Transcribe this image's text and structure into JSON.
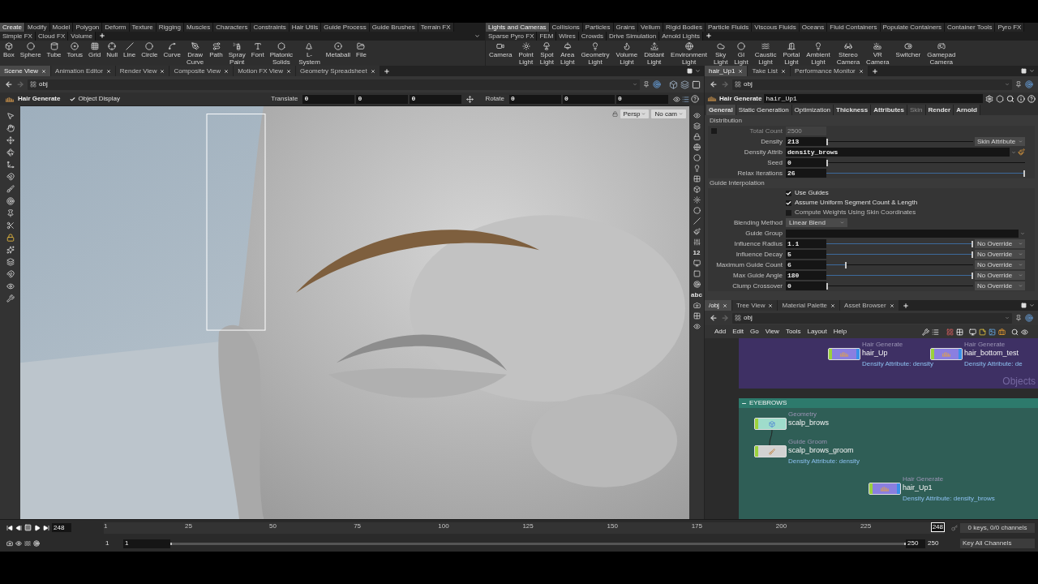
{
  "shelf": {
    "left_tabs": [
      {
        "label": "Create",
        "selected": true
      },
      {
        "label": "Modify",
        "selected": false
      },
      {
        "label": "Model",
        "selected": false
      },
      {
        "label": "Polygon",
        "selected": false
      },
      {
        "label": "Deform",
        "selected": false
      },
      {
        "label": "Texture",
        "selected": false
      },
      {
        "label": "Rigging",
        "selected": false
      },
      {
        "label": "Muscles",
        "selected": false
      },
      {
        "label": "Characters",
        "selected": false
      },
      {
        "label": "Constraints",
        "selected": false
      },
      {
        "label": "Hair Utils",
        "selected": false
      },
      {
        "label": "Guide Process",
        "selected": false
      },
      {
        "label": "Guide Brushes",
        "selected": false
      },
      {
        "label": "Terrain FX",
        "selected": false
      },
      {
        "label": "Simple FX",
        "selected": false
      },
      {
        "label": "Cloud FX",
        "selected": false
      },
      {
        "label": "Volume",
        "selected": false
      }
    ],
    "left_tools": [
      "Box",
      "Sphere",
      "Tube",
      "Torus",
      "Grid",
      "Null",
      "Line",
      "Circle",
      "Curve",
      "Draw Curve",
      "Path",
      "Spray Paint",
      "Font",
      "Platonic Solids",
      "L-System",
      "Metaball",
      "File"
    ],
    "right_tabs": [
      {
        "label": "Lights and Cameras",
        "selected": true
      },
      {
        "label": "Collisions",
        "selected": false
      },
      {
        "label": "Particles",
        "selected": false
      },
      {
        "label": "Grains",
        "selected": false
      },
      {
        "label": "Vellum",
        "selected": false
      },
      {
        "label": "Rigid Bodies",
        "selected": false
      },
      {
        "label": "Particle Fluids",
        "selected": false
      },
      {
        "label": "Viscous Fluids",
        "selected": false
      },
      {
        "label": "Oceans",
        "selected": false
      },
      {
        "label": "Fluid Containers",
        "selected": false
      },
      {
        "label": "Populate Containers",
        "selected": false
      },
      {
        "label": "Container Tools",
        "selected": false
      },
      {
        "label": "Pyro FX",
        "selected": false
      },
      {
        "label": "Sparse Pyro FX",
        "selected": false
      },
      {
        "label": "FEM",
        "selected": false
      },
      {
        "label": "Wires",
        "selected": false
      },
      {
        "label": "Crowds",
        "selected": false
      },
      {
        "label": "Drive Simulation",
        "selected": false
      },
      {
        "label": "Arnold Lights",
        "selected": false
      }
    ],
    "right_tools": [
      "Camera",
      "Point Light",
      "Spot Light",
      "Area Light",
      "Geometry Light",
      "Volume Light",
      "Distant Light",
      "Environment Light",
      "Sky Light",
      "GI Light",
      "Caustic Light",
      "Portal Light",
      "Ambient Light",
      "Stereo Camera",
      "VR Camera",
      "Switcher",
      "Gamepad Camera"
    ]
  },
  "scene_pane": {
    "tabs": [
      {
        "label": "Scene View",
        "selected": true
      },
      {
        "label": "Animation Editor",
        "selected": false
      },
      {
        "label": "Render View",
        "selected": false
      },
      {
        "label": "Composite View",
        "selected": false
      },
      {
        "label": "Motion FX View",
        "selected": false
      },
      {
        "label": "Geometry Spreadsheet",
        "selected": false
      }
    ],
    "path": "obj",
    "operation": "Hair Generate",
    "object_display": {
      "label": "Object Display",
      "checked": true
    },
    "translate": {
      "label": "Translate",
      "values": [
        "0",
        "0",
        "0"
      ]
    },
    "rotate": {
      "label": "Rotate",
      "values": [
        "0",
        "0",
        "0"
      ]
    },
    "camera_menus": [
      "Persp",
      "No cam"
    ],
    "display_labels": [
      "12",
      "abc"
    ]
  },
  "param_pane": {
    "tabs": [
      {
        "label": "hair_Up1",
        "selected": true
      },
      {
        "label": "Take List",
        "selected": false
      },
      {
        "label": "Performance Monitor",
        "selected": false
      }
    ],
    "path": "obj",
    "node_type": "Hair Generate",
    "node_name": "hair_Up1",
    "folders": [
      {
        "label": "General",
        "selected": true,
        "modified": true
      },
      {
        "label": "Static Generation",
        "selected": false,
        "modified": false
      },
      {
        "label": "Optimization",
        "selected": false,
        "modified": false
      },
      {
        "label": "Thickness",
        "selected": false,
        "modified": true
      },
      {
        "label": "Attributes",
        "selected": false,
        "modified": true
      },
      {
        "label": "Skin",
        "selected": false,
        "modified": false,
        "disabled": true
      },
      {
        "label": "Render",
        "selected": false,
        "modified": true
      },
      {
        "label": "Arnold",
        "selected": false,
        "modified": true
      }
    ],
    "sections": [
      {
        "title": "Distribution",
        "params": [
          {
            "kind": "toggle_number",
            "label": "Total Count",
            "value": "2500",
            "checked": false
          },
          {
            "kind": "slider",
            "label": "Density",
            "value": "213",
            "level": 0,
            "menu": "Skin Attribute"
          },
          {
            "kind": "attrib",
            "label": "Density Attrib",
            "value": "density_brows"
          },
          {
            "kind": "slider",
            "label": "Seed",
            "value": "0",
            "level": 0
          },
          {
            "kind": "slider",
            "label": "Relax Iterations",
            "value": "26",
            "level": 1
          }
        ]
      },
      {
        "title": "Guide Interpolation",
        "params": [
          {
            "kind": "checkbox",
            "label": "Use Guides",
            "checked": true
          },
          {
            "kind": "checkbox",
            "label": "Assume Uniform Segment Count & Length",
            "checked": true
          },
          {
            "kind": "checkbox",
            "label": "Compute Weights Using Skin Coordinates",
            "checked": false
          },
          {
            "kind": "menu",
            "label": "Blending Method",
            "value": "Linear Blend"
          },
          {
            "kind": "string",
            "label": "Guide Group"
          },
          {
            "kind": "slider",
            "label": "Influence Radius",
            "value": "1.1",
            "level": 1,
            "menu": "No Override"
          },
          {
            "kind": "slider",
            "label": "Influence Decay",
            "value": "5",
            "level": 1,
            "menu": "No Override"
          },
          {
            "kind": "slider",
            "label": "Maximum Guide Count",
            "value": "6",
            "level": 0.13,
            "menu": "No Override"
          },
          {
            "kind": "slider",
            "label": "Max Guide Angle",
            "value": "180",
            "level": 1,
            "menu": "No Override"
          },
          {
            "kind": "slider",
            "label": "Clump Crossover",
            "value": "0",
            "level": 0,
            "menu": "No Override"
          }
        ]
      }
    ]
  },
  "network_pane": {
    "tabs": [
      {
        "label": "/obj",
        "selected": true
      },
      {
        "label": "Tree View",
        "selected": false
      },
      {
        "label": "Material Palette",
        "selected": false
      },
      {
        "label": "Asset Browser",
        "selected": false
      }
    ],
    "path": "obj",
    "menu": [
      "Add",
      "Edit",
      "Go",
      "View",
      "Tools",
      "Layout",
      "Help"
    ],
    "boxes": [
      {
        "title": "Objects",
        "kind": "objects",
        "nodes": [
          {
            "type": "Hair Generate",
            "name": "hair_Up",
            "info": "Density Attribute: density",
            "kind": "hair"
          },
          {
            "type": "Hair Generate",
            "name": "hair_bottom_test",
            "info": "Density Attribute: de",
            "kind": "hair"
          }
        ]
      },
      {
        "title": "EYEBROWS",
        "kind": "group",
        "nodes": [
          {
            "type": "Geometry",
            "name": "scalp_brows",
            "kind": "geometry"
          },
          {
            "type": "Guide Groom",
            "name": "scalp_brows_groom",
            "info": "Density Attribute: density",
            "kind": "groom"
          },
          {
            "type": "Hair Generate",
            "name": "hair_Up1",
            "info": "Density Attribute: density_brows",
            "kind": "hair"
          }
        ]
      }
    ]
  },
  "timeline": {
    "frame": "248",
    "ticks": [
      "1",
      "25",
      "50",
      "75",
      "100",
      "125",
      "150",
      "175",
      "200",
      "225"
    ],
    "marker": "248",
    "start": "1",
    "start_field": "1",
    "end_field": "250",
    "end": "250",
    "keys": "0 keys, 0/0 channels",
    "key_menu": "Key All Channels"
  }
}
